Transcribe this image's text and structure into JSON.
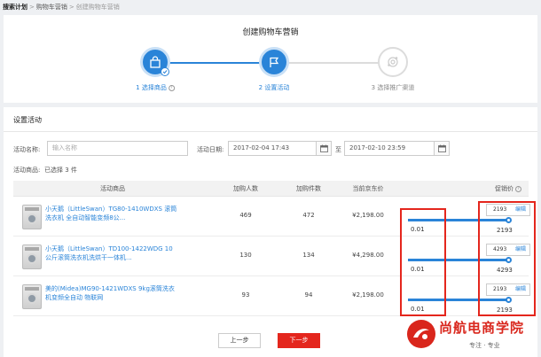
{
  "breadcrumb": {
    "root": "搜索计划",
    "level2": "购物车营销",
    "current": "创建购物车营销",
    "sep": ">"
  },
  "page_title": "创建购物车营销",
  "steps": [
    {
      "label": "1 选择商品",
      "state": "done",
      "help": "?"
    },
    {
      "label": "2 设置活动",
      "state": "active"
    },
    {
      "label": "3 选择推广渠道",
      "state": "todo"
    }
  ],
  "section_title": "设置活动",
  "form": {
    "name_label": "活动名称:",
    "name_placeholder": "输入名称",
    "date_label": "活动日期:",
    "start_date": "2017-02-04 17:43",
    "date_sep": "至",
    "end_date": "2017-02-10 23:59",
    "goods_label": "活动商品:",
    "goods_count": "已选择 3 件"
  },
  "table": {
    "headers": [
      "活动商品",
      "加购人数",
      "加购件数",
      "当前京东价",
      "促销价",
      "?"
    ],
    "rows": [
      {
        "name": "小天鹅（LittleSwan）TG80-1410WDXS 滚筒洗衣机 全自动智能变频8公...",
        "add_people": "469",
        "add_items": "472",
        "price": "¥2,198.00",
        "min": "0.01",
        "max_input": "2193",
        "max": "2193",
        "edit": "编辑",
        "slider_fraction": 1.0
      },
      {
        "name": "小天鹅（LittleSwan）TD100-1422WDG 10公斤滚筒洗衣机洗烘干一体机...",
        "add_people": "130",
        "add_items": "134",
        "price": "¥4,298.00",
        "min": "0.01",
        "max_input": "4293",
        "max": "4293",
        "edit": "编辑",
        "slider_fraction": 1.0
      },
      {
        "name": "美的(Midea)MG90-1421WDXS 9kg滚筒洗衣机变频全自动 物联网",
        "add_people": "93",
        "add_items": "94",
        "price": "¥2,198.00",
        "min": "0.01",
        "max_input": "2193",
        "max": "2193",
        "edit": "编辑",
        "slider_fraction": 1.0
      }
    ]
  },
  "buttons": {
    "prev": "上一步",
    "next": "下一步"
  },
  "watermark": {
    "title": "尚航电商学院",
    "subtitle": "专注 · 专业"
  },
  "colors": {
    "accent": "#2a84d8",
    "danger": "#e4261d"
  },
  "icons": {
    "step1": "shopping-bag-icon",
    "step2": "flag-icon",
    "step3": "channel-icon",
    "calendar": "calendar-icon"
  }
}
